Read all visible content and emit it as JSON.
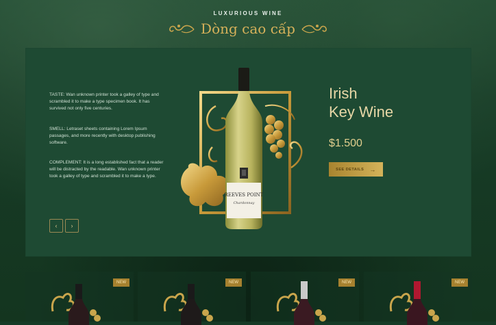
{
  "header": {
    "kicker": "LUXURIOUS WINE",
    "title": "Dòng cao cấp"
  },
  "featured": {
    "descriptions": [
      "TASTE: Wan unknown printer took a galley of type and scrambled it to make a type specimen book. It has survived not only five centuries.",
      "SMELL: Letraset sheets containing Lorem Ipsum passages, and more recently with desktop publishing software.",
      "COMPLEMENT: It is a long established fact that a reader will be distracted by the readable. Wan unknown printer took a galley of type and scrambled it to make a type."
    ],
    "name_line1": "Irish",
    "name_line2": "Key Wine",
    "price": "$1.500",
    "button_label": "SEE DETAILS",
    "label_brand": "REEVES POINT",
    "label_variety": "Chardonnay",
    "nav": {
      "prev_icon": "chevron-left-icon",
      "next_icon": "chevron-right-icon"
    }
  },
  "products": [
    {
      "badge": "NEW",
      "cap_color": "#1a1a1a"
    },
    {
      "badge": "NEW",
      "cap_color": "#1a1a1a"
    },
    {
      "badge": "NEW",
      "cap_color": "#c9c9c9"
    },
    {
      "badge": "NEW",
      "cap_color": "#b01830"
    }
  ],
  "colors": {
    "background": "#163a26",
    "panel": "#1e4a33",
    "gold": "#d4b35a",
    "badge": "#a6812f"
  }
}
